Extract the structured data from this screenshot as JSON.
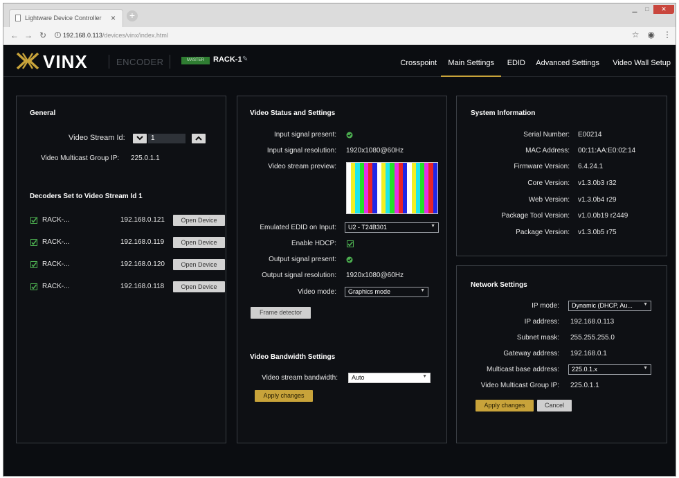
{
  "browser": {
    "tab_title": "Lightware Device Controller",
    "tab_close": "×",
    "url_host": "192.168.0.113",
    "url_path": "/devices/vinx/index.html"
  },
  "header": {
    "logo_text": "VINX",
    "product_type": "ENCODER",
    "role_badge": "MASTER",
    "device_name": "RACK-1",
    "nav": [
      "Crosspoint",
      "Main Settings",
      "EDID",
      "Advanced Settings",
      "Video Wall Setup"
    ],
    "active_nav": "Main Settings"
  },
  "general": {
    "title": "General",
    "stream_id_label": "Video Stream Id:",
    "stream_id_value": "1",
    "multicast_label": "Video Multicast Group IP:",
    "multicast_value": "225.0.1.1",
    "decoders_title": "Decoders Set to Video Stream Id 1",
    "decoders": [
      {
        "name": "RACK-...",
        "ip": "192.168.0.121",
        "button": "Open Device",
        "checked": true
      },
      {
        "name": "RACK-...",
        "ip": "192.168.0.119",
        "button": "Open Device",
        "checked": true
      },
      {
        "name": "RACK-...",
        "ip": "192.168.0.120",
        "button": "Open Device",
        "checked": true
      },
      {
        "name": "RACK-...",
        "ip": "192.168.0.118",
        "button": "Open Device",
        "checked": true
      }
    ]
  },
  "video": {
    "title": "Video Status and Settings",
    "input_present_label": "Input signal present:",
    "input_resolution_label": "Input signal resolution:",
    "input_resolution_value": "1920x1080@60Hz",
    "preview_label": "Video stream preview:",
    "preview_colors": [
      "#ffffff",
      "#f3ef22",
      "#1fe6ea",
      "#21e12a",
      "#e52ee9",
      "#e8242a",
      "#2026e7",
      "#ffffff",
      "#f3ef22",
      "#1fe6ea",
      "#21e12a",
      "#e52ee9",
      "#e8242a",
      "#2026e7",
      "#ffffff",
      "#f3ef22",
      "#1fe6ea",
      "#21e12a",
      "#e52ee9",
      "#e8242a",
      "#2026e7"
    ],
    "edid_label": "Emulated EDID on Input:",
    "edid_value": "U2 - T24B301",
    "hdcp_label": "Enable HDCP:",
    "output_present_label": "Output signal present:",
    "output_resolution_label": "Output signal resolution:",
    "output_resolution_value": "1920x1080@60Hz",
    "mode_label": "Video mode:",
    "mode_value": "Graphics mode",
    "frame_detector_button": "Frame detector",
    "bandwidth_title": "Video Bandwidth Settings",
    "bandwidth_label": "Video stream bandwidth:",
    "bandwidth_value": "Auto",
    "apply_button": "Apply changes"
  },
  "system": {
    "title": "System Information",
    "rows": [
      {
        "label": "Serial Number:",
        "value": "E00214"
      },
      {
        "label": "MAC Address:",
        "value": "00:11:AA:E0:02:14"
      },
      {
        "label": "Firmware Version:",
        "value": "6.4.24.1"
      },
      {
        "label": "Core Version:",
        "value": "v1.3.0b3 r32"
      },
      {
        "label": "Web Version:",
        "value": "v1.3.0b4 r29"
      },
      {
        "label": "Package Tool Version:",
        "value": "v1.0.0b19 r2449"
      },
      {
        "label": "Package Version:",
        "value": "v1.3.0b5 r75"
      }
    ]
  },
  "network": {
    "title": "Network Settings",
    "ip_mode_label": "IP mode:",
    "ip_mode_value": "Dynamic (DHCP, Au...",
    "ip_address_label": "IP address:",
    "ip_address_value": "192.168.0.113",
    "subnet_label": "Subnet mask:",
    "subnet_value": "255.255.255.0",
    "gateway_label": "Gateway address:",
    "gateway_value": "192.168.0.1",
    "multicast_base_label": "Multicast base address:",
    "multicast_base_value": "225.0.1.x",
    "multicast_group_label": "Video Multicast Group IP:",
    "multicast_group_value": "225.0.1.1",
    "apply_button": "Apply changes",
    "cancel_button": "Cancel"
  },
  "colors": {
    "accent_gold": "#c8a33a",
    "status_green": "#4caf50",
    "panel_bg": "#0e1014",
    "app_bg": "#0b0d11"
  }
}
